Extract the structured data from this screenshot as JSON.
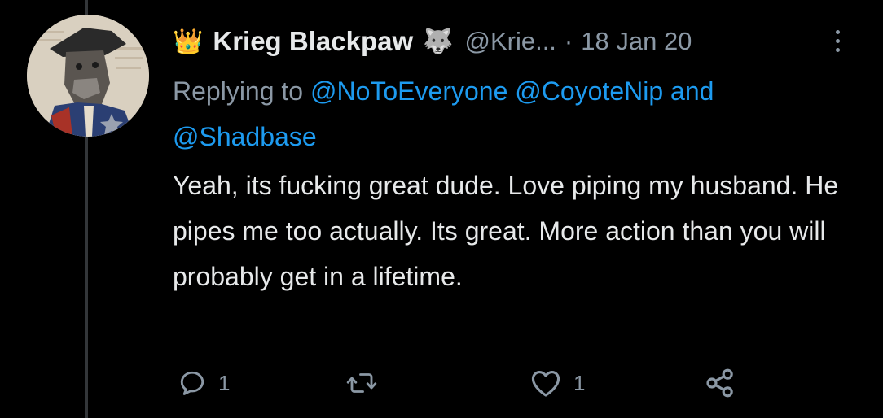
{
  "author": {
    "crown_emoji": "👑",
    "display_name": "Krieg Blackpaw",
    "badge_emoji": "🐺",
    "handle": "@Krie...",
    "separator": "·",
    "date": "18 Jan 20"
  },
  "reply_context": {
    "prefix": "Replying to",
    "mention_1": "@NoToEveryone",
    "mention_2": "@CoyoteNip",
    "conjunction": "and",
    "mention_3": "@Shadbase"
  },
  "tweet": {
    "text": "Yeah, its fucking great dude. Love piping my husband. He pipes me too actually. Its great. More action than you will probably get in a lifetime."
  },
  "actions": {
    "reply_icon": "reply-icon",
    "reply_count": "1",
    "retweet_icon": "retweet-icon",
    "like_icon": "heart-icon",
    "like_count": "1",
    "share_icon": "share-icon"
  },
  "colors": {
    "background": "#000000",
    "text": "#e7e9ea",
    "secondary": "#8b98a5",
    "link": "#1d9bf0",
    "thread_line": "#333639"
  }
}
